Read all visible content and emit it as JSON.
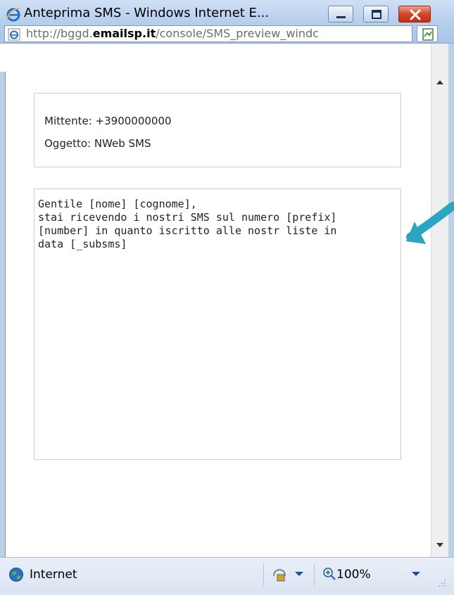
{
  "window": {
    "title": "Anteprima SMS - Windows Internet E...",
    "address_prefix": "http://bggd.",
    "address_domain": "emailsp.it",
    "address_path": "/console/SMS_preview_windc"
  },
  "preview": {
    "sender_label": "Mittente: +3900000000",
    "subject_label": "Oggetto: NWeb SMS",
    "message_body": "Gentile [nome] [cognome],\nstai ricevendo i nostri SMS sul numero [prefix]\n[number] in quanto iscritto alle nostr liste in\ndata [_subsms]"
  },
  "statusbar": {
    "zone": "Internet",
    "zoom": "100%"
  },
  "colors": {
    "annotation_arrow": "#2aa6c2",
    "titlebar": "#b9d0ee",
    "close_button": "#d5472a"
  },
  "icons": {
    "window": "ie-logo-icon",
    "favicon": "ie-page-icon",
    "compat": "compatibility-view-icon",
    "zone": "globe-icon",
    "protected_mode": "protected-mode-icon",
    "zoom": "zoom-icon"
  }
}
